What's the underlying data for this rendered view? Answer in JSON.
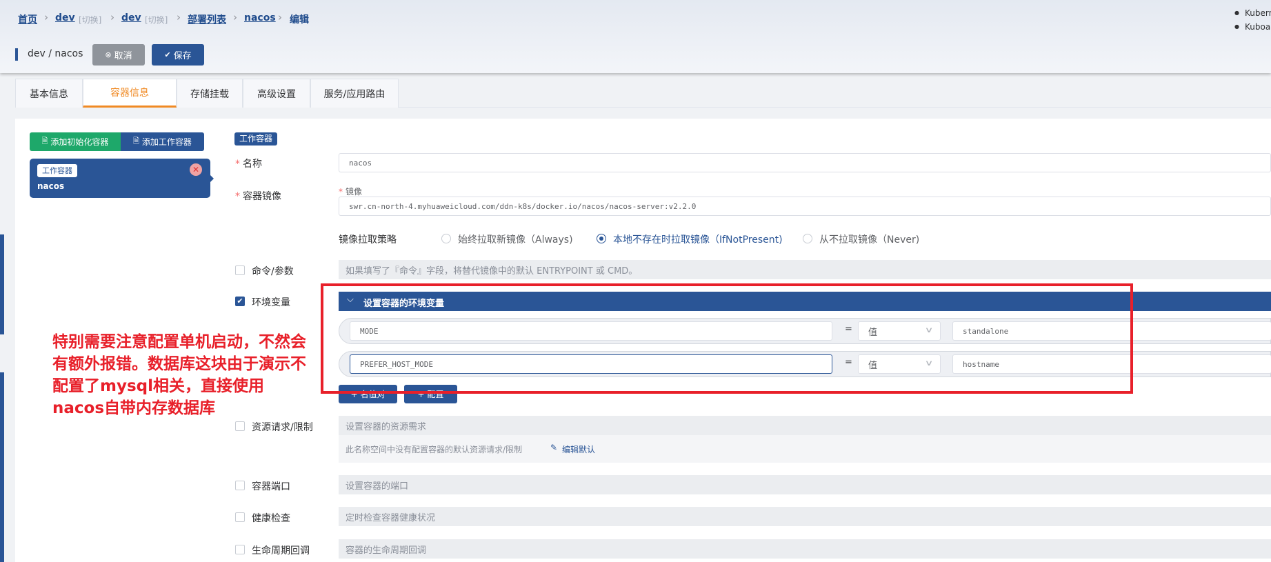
{
  "breadcrumb": {
    "home": "首页",
    "cluster": "dev",
    "cluster_switch": "[切换]",
    "namespace": "dev",
    "namespace_switch": "[切换]",
    "list": "部署列表",
    "name": "nacos",
    "current": "编辑"
  },
  "header_right": [
    "Kubern",
    "Kuboar"
  ],
  "toolbar": {
    "title": "dev / nacos",
    "cancel_label": "取消",
    "save_label": "保存"
  },
  "tabs": [
    {
      "label": "基本信息",
      "active": false
    },
    {
      "label": "容器信息",
      "active": true
    },
    {
      "label": "存储挂载",
      "active": false
    },
    {
      "label": "高级设置",
      "active": false
    },
    {
      "label": "服务/应用路由",
      "active": false
    }
  ],
  "container_list": {
    "add_init_label": "添加初始化容器",
    "add_work_label": "添加工作容器",
    "card_tag": "工作容器",
    "card_name": "nacos"
  },
  "form": {
    "type_tag": "工作容器",
    "name_label": "名称",
    "name_value": "nacos",
    "image_section_label": "容器镜像",
    "image_sub_label": "镜像",
    "image_value": "swr.cn-north-4.myhuaweicloud.com/ddn-k8s/docker.io/nacos/nacos-server:v2.2.0",
    "pull_policy_label": "镜像拉取策略",
    "pull_options": [
      {
        "label": "始终拉取新镜像（Always)",
        "selected": false
      },
      {
        "label": "本地不存在时拉取镜像（IfNotPresent)",
        "selected": true
      },
      {
        "label": "从不拉取镜像（Never)",
        "selected": false
      }
    ],
    "command_label": "命令/参数",
    "command_checked": false,
    "command_hint": "如果填写了『命令』字段，将替代镜像中的默认 ENTRYPOINT 或 CMD。",
    "env_label": "环境变量",
    "env_checked": true,
    "env_header": "设置容器的环境变量",
    "env_vars": [
      {
        "name": "MODE",
        "eq": "=",
        "type": "值",
        "value": "standalone"
      },
      {
        "name": "PREFER_HOST_MODE",
        "eq": "=",
        "type": "值",
        "value": "hostname"
      }
    ],
    "env_add_name_label": "名值对",
    "env_add_config_label": "配置",
    "resources_label": "资源请求/限制",
    "resources_checked": false,
    "resources_hint": "设置容器的资源需求",
    "resources_note": "此名称空间中没有配置容器的默认资源请求/限制",
    "resources_edit_label": "编辑默认",
    "ports_label": "容器端口",
    "ports_checked": false,
    "ports_hint": "设置容器的端口",
    "health_label": "健康检查",
    "health_checked": false,
    "health_hint": "定时检查容器健康状况",
    "lifecycle_label": "生命周期回调",
    "lifecycle_checked": false,
    "lifecycle_hint": "容器的生命周期回调"
  },
  "annotation": {
    "text": "特别需要注意配置单机启动，不然会有额外报错。数据库这块由于演示不配置了mysql相关，直接使用nacos自带内存数据库",
    "color": "#e8202a"
  },
  "colors": {
    "primary": "#2a5596",
    "green": "#1ea86a",
    "orange": "#f08a24",
    "gray_button": "#8f949b",
    "red_box": "#e8202a"
  }
}
